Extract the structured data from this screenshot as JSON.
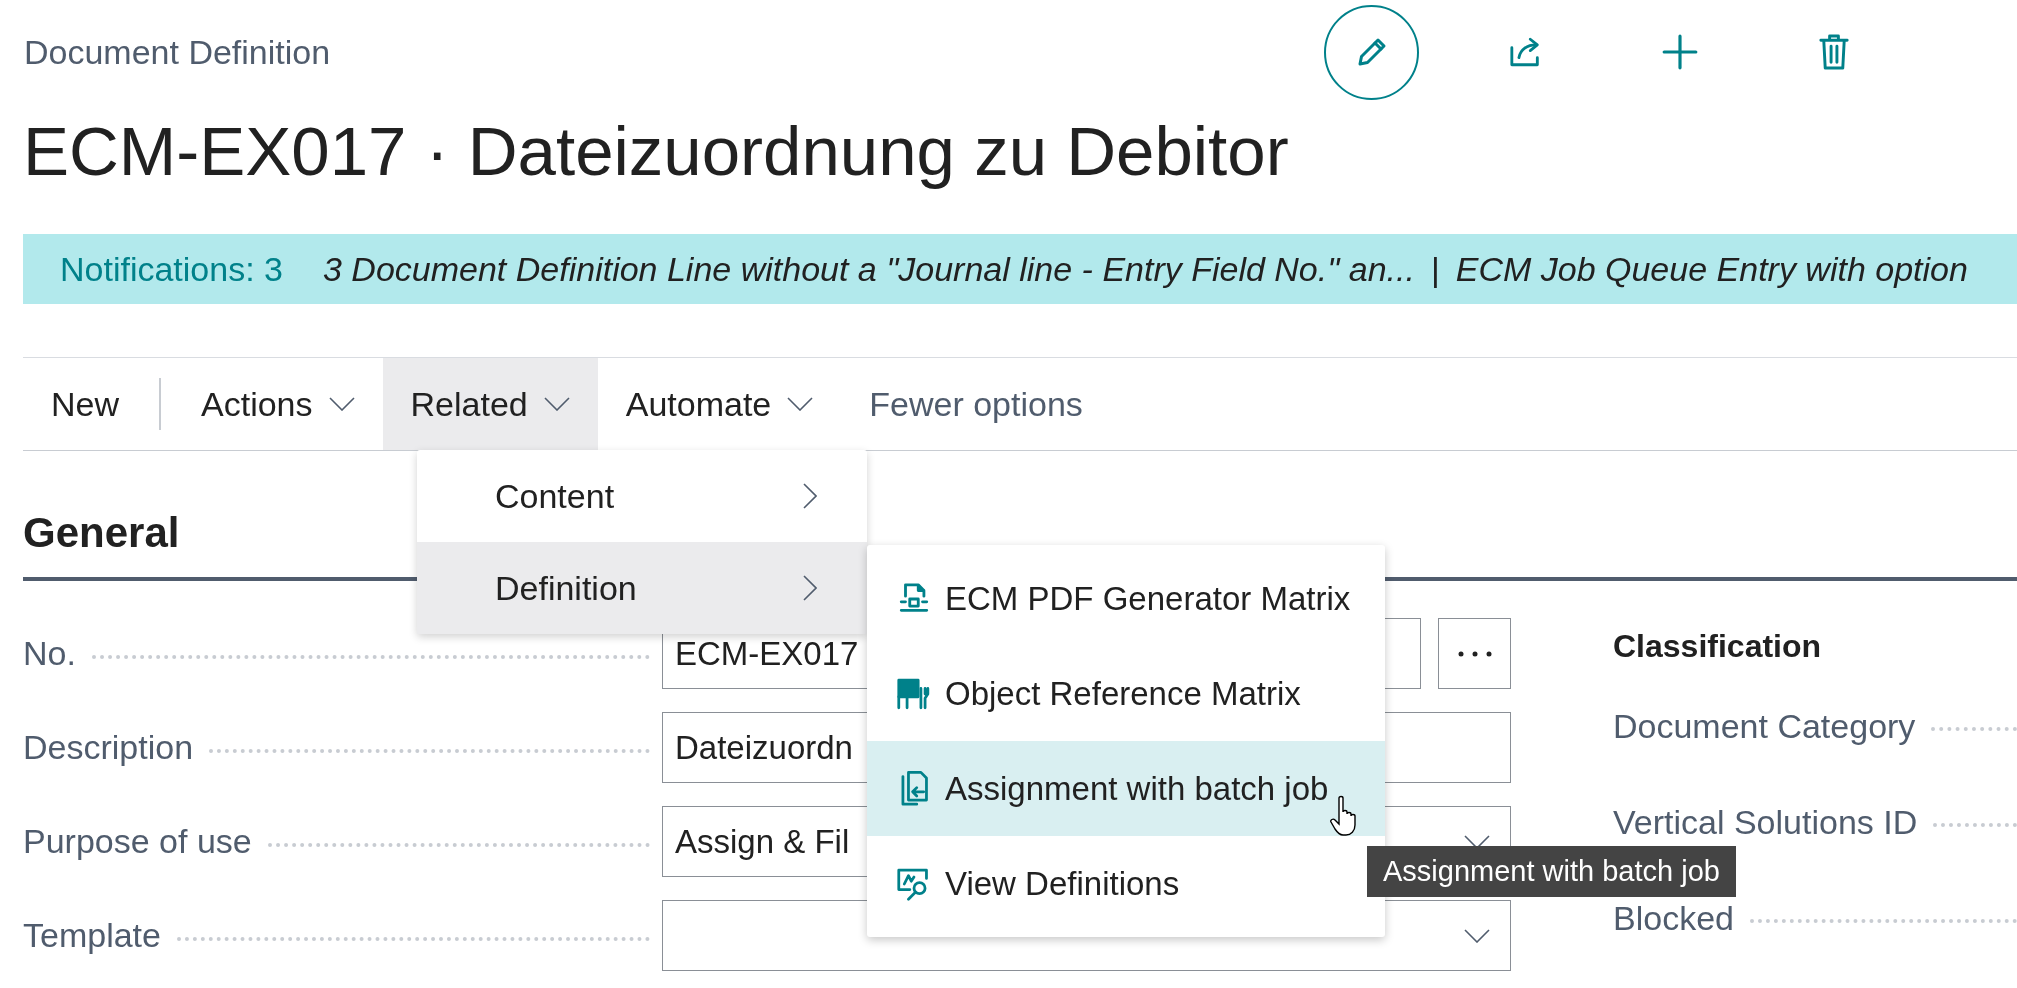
{
  "page": {
    "caption": "Document Definition",
    "title": "ECM-EX017 · Dateizuordnung zu Debitor"
  },
  "header_actions": [
    {
      "kind": "edit"
    },
    {
      "kind": "share"
    },
    {
      "kind": "new"
    },
    {
      "kind": "delete"
    }
  ],
  "notifications": {
    "label": "Notifications: 3",
    "messages": [
      "3 Document Definition Line without a \"Journal line - Entry Field No.\" an...",
      "ECM Job Queue Entry with option"
    ],
    "separator": "|"
  },
  "action_bar": [
    {
      "label": "New",
      "kind": "button",
      "selected": false
    },
    {
      "label": "Actions",
      "kind": "menu",
      "selected": false
    },
    {
      "label": "Related",
      "kind": "menu",
      "selected": true
    },
    {
      "label": "Automate",
      "kind": "menu",
      "selected": false
    },
    {
      "label": "Fewer options",
      "kind": "link",
      "selected": false
    }
  ],
  "menu": [
    {
      "label": "Content",
      "selected": false
    },
    {
      "label": "Definition",
      "selected": true
    }
  ],
  "submenu": [
    {
      "label": "ECM PDF Generator Matrix",
      "kind": "pdf",
      "selected": false
    },
    {
      "label": "Object Reference Matrix",
      "kind": "matrix",
      "selected": false
    },
    {
      "label": "Assignment with batch job",
      "kind": "assign",
      "selected": true
    },
    {
      "label": "View Definitions",
      "kind": "view",
      "selected": false
    }
  ],
  "tooltip": "Assignment with batch job",
  "section": {
    "title": "General",
    "fields": [
      {
        "label": "No.",
        "value": "ECM-EX017",
        "kind": "assist"
      },
      {
        "label": "Description",
        "value": "Dateizuordn",
        "kind": "text"
      },
      {
        "label": "Purpose of use",
        "value": "Assign & Fil",
        "kind": "dropdown"
      },
      {
        "label": "Template",
        "kind": "dropdown"
      }
    ],
    "side_group": {
      "title": "Classification",
      "fields": [
        {
          "label": "Document Category"
        },
        {
          "label": "Vertical Solutions ID"
        },
        {
          "label": "Blocked"
        }
      ]
    }
  }
}
